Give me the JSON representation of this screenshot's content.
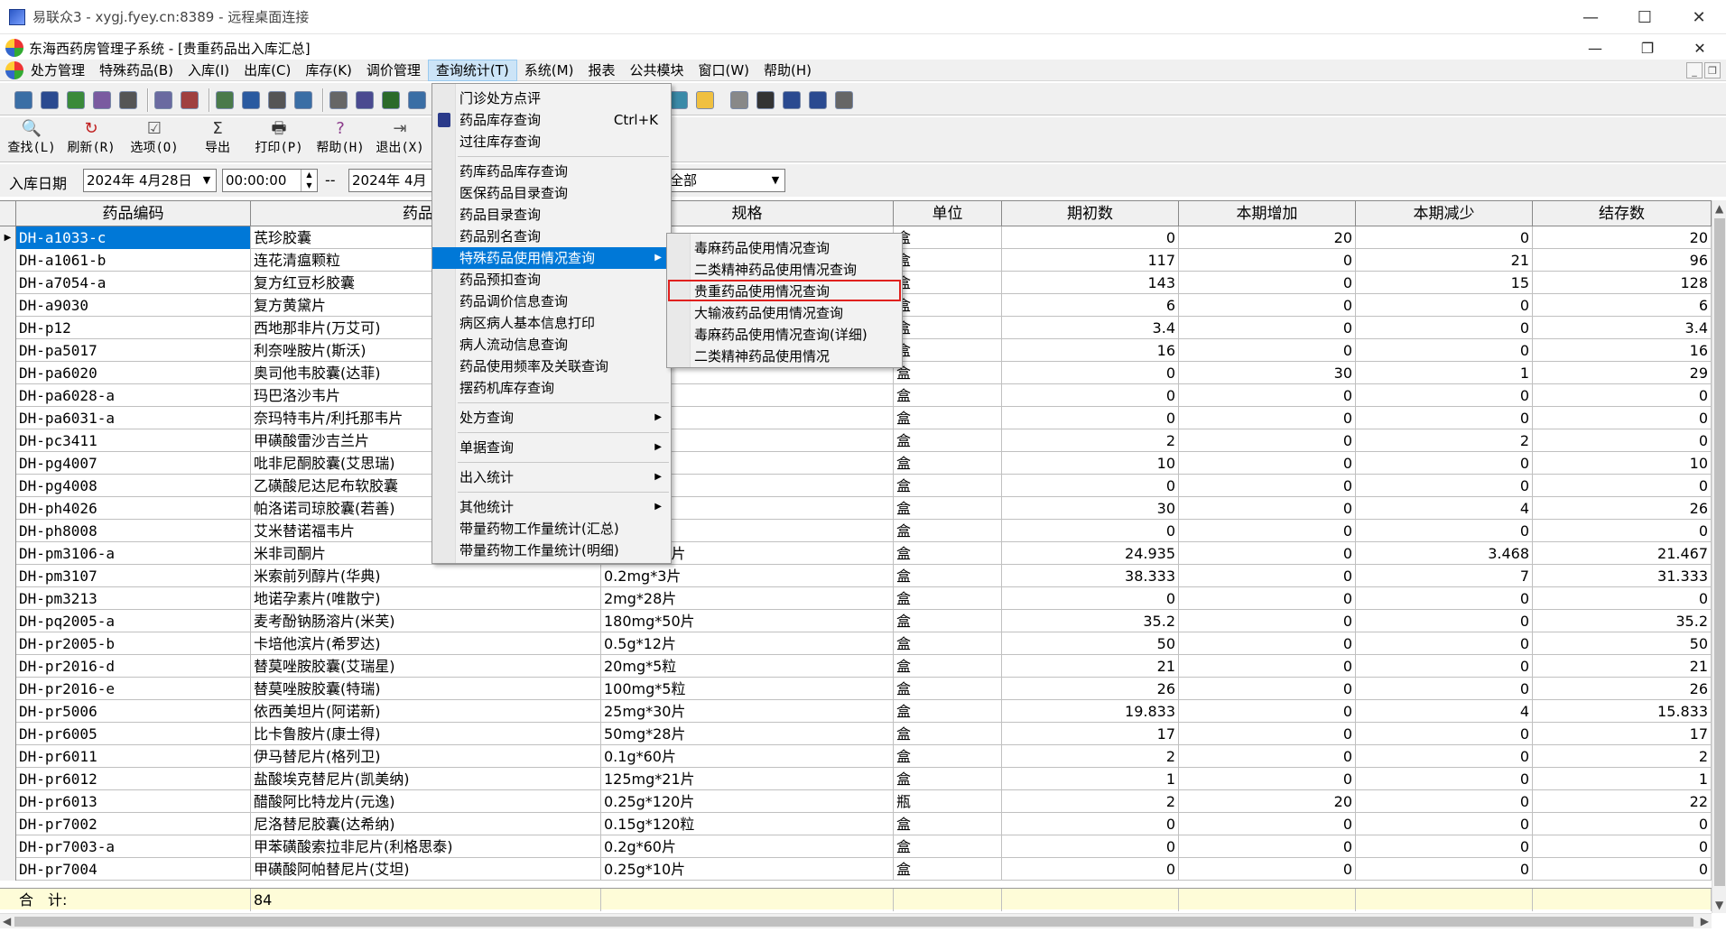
{
  "rd_window": {
    "title": "易联众3 - xygj.fyey.cn:8389 - 远程桌面连接",
    "minimize": "—",
    "maximize": "☐",
    "close": "✕"
  },
  "app_window": {
    "title": "东海西药房管理子系统 - [贵重药品出入库汇总]",
    "minimize": "—",
    "restore": "❐",
    "close": "✕"
  },
  "menubar": {
    "items": [
      "处方管理",
      "特殊药品(B)",
      "入库(I)",
      "出库(C)",
      "库存(K)",
      "调价管理",
      "查询统计(T)",
      "系统(M)",
      "报表",
      "公共模块",
      "窗口(W)",
      "帮助(H)"
    ],
    "active_index": 6,
    "mdi_minimize": "_",
    "mdi_restore": "❐"
  },
  "toolbar": {
    "buttons": [
      {
        "label": "查找(L)",
        "icon": "search-icon",
        "glyph": "🔍"
      },
      {
        "label": "刷新(R)",
        "icon": "refresh-icon",
        "glyph": "↻"
      },
      {
        "label": "选项(O)",
        "icon": "options-icon",
        "glyph": "☑"
      },
      {
        "label": "导出",
        "icon": "export-icon",
        "glyph": "Σ"
      },
      {
        "label": "打印(P)",
        "icon": "print-icon",
        "glyph": "🖶"
      },
      {
        "label": "帮助(H)",
        "icon": "help-icon",
        "glyph": "?"
      },
      {
        "label": "退出(X)",
        "icon": "exit-icon",
        "glyph": "⇥"
      }
    ]
  },
  "filter": {
    "label": "入库日期",
    "start_date": "2024年 4月28日",
    "start_time": "00:00:00",
    "separator": "--",
    "end_date": "2024年 4月",
    "scope": "全部"
  },
  "grid": {
    "columns": [
      "药品编码",
      "药品名",
      "规格",
      "单位",
      "期初数",
      "本期增加",
      "本期减少",
      "结存数"
    ],
    "rows": [
      [
        "DH-a1033-c",
        "芪珍胶囊",
        "",
        "盒",
        "0",
        "20",
        "0",
        "20"
      ],
      [
        "DH-a1061-b",
        "连花清瘟颗粒",
        "",
        "盒",
        "117",
        "0",
        "21",
        "96"
      ],
      [
        "DH-a7054-a",
        "复方红豆杉胶囊",
        "",
        "盒",
        "143",
        "0",
        "15",
        "128"
      ],
      [
        "DH-a9030",
        "复方黄黛片",
        "",
        "盒",
        "6",
        "0",
        "0",
        "6"
      ],
      [
        "DH-p12",
        "西地那非片(万艾可)",
        "",
        "盒",
        "3.4",
        "0",
        "0",
        "3.4"
      ],
      [
        "DH-pa5017",
        "利奈唑胺片(斯沃)",
        "",
        "盒",
        "16",
        "0",
        "0",
        "16"
      ],
      [
        "DH-pa6020",
        "奥司他韦胶囊(达菲)",
        "粒",
        "盒",
        "0",
        "30",
        "1",
        "29"
      ],
      [
        "DH-pa6028-a",
        "玛巴洛沙韦片",
        "",
        "盒",
        "0",
        "0",
        "0",
        "0"
      ],
      [
        "DH-pa6031-a",
        "奈玛特韦片/利托那韦片",
        ":1)*10剂",
        "盒",
        "0",
        "0",
        "0",
        "0"
      ],
      [
        "DH-pc3411",
        "甲磺酸雷沙吉兰片",
        "",
        "盒",
        "2",
        "0",
        "2",
        "0"
      ],
      [
        "DH-pg4007",
        "吡非尼酮胶囊(艾思瑞)",
        "粒",
        "盒",
        "10",
        "0",
        "0",
        "10"
      ],
      [
        "DH-pg4008",
        "乙磺酸尼达尼布软胶囊",
        "0粒",
        "盒",
        "0",
        "0",
        "0",
        "0"
      ],
      [
        "DH-ph4026",
        "帕洛诺司琼胶囊(若善)",
        "粒",
        "盒",
        "30",
        "0",
        "4",
        "26"
      ],
      [
        "DH-ph8008",
        "艾米替诺福韦片",
        "片",
        "盒",
        "0",
        "0",
        "0",
        "0"
      ],
      [
        "DH-pm3106-a",
        "米非司酮片",
        "10mg*30片",
        "盒",
        "24.935",
        "0",
        "3.468",
        "21.467"
      ],
      [
        "DH-pm3107",
        "米索前列醇片(华典)",
        "0.2mg*3片",
        "盒",
        "38.333",
        "0",
        "7",
        "31.333"
      ],
      [
        "DH-pm3213",
        "地诺孕素片(唯散宁)",
        "2mg*28片",
        "盒",
        "0",
        "0",
        "0",
        "0"
      ],
      [
        "DH-pq2005-a",
        "麦考酚钠肠溶片(米芙)",
        "180mg*50片",
        "盒",
        "35.2",
        "0",
        "0",
        "35.2"
      ],
      [
        "DH-pr2005-b",
        "卡培他滨片(希罗达)",
        "0.5g*12片",
        "盒",
        "50",
        "0",
        "0",
        "50"
      ],
      [
        "DH-pr2016-d",
        "替莫唑胺胶囊(艾瑞星)",
        "20mg*5粒",
        "盒",
        "21",
        "0",
        "0",
        "21"
      ],
      [
        "DH-pr2016-e",
        "替莫唑胺胶囊(特瑞)",
        "100mg*5粒",
        "盒",
        "26",
        "0",
        "0",
        "26"
      ],
      [
        "DH-pr5006",
        "依西美坦片(阿诺新)",
        "25mg*30片",
        "盒",
        "19.833",
        "0",
        "4",
        "15.833"
      ],
      [
        "DH-pr6005",
        "比卡鲁胺片(康士得)",
        "50mg*28片",
        "盒",
        "17",
        "0",
        "0",
        "17"
      ],
      [
        "DH-pr6011",
        "伊马替尼片(格列卫)",
        "0.1g*60片",
        "盒",
        "2",
        "0",
        "0",
        "2"
      ],
      [
        "DH-pr6012",
        "盐酸埃克替尼片(凯美纳)",
        "125mg*21片",
        "盒",
        "1",
        "0",
        "0",
        "1"
      ],
      [
        "DH-pr6013",
        "醋酸阿比特龙片(元逸)",
        "0.25g*120片",
        "瓶",
        "2",
        "20",
        "0",
        "22"
      ],
      [
        "DH-pr7002",
        "尼洛替尼胶囊(达希纳)",
        "0.15g*120粒",
        "盒",
        "0",
        "0",
        "0",
        "0"
      ],
      [
        "DH-pr7003-a",
        "甲苯磺酸索拉非尼片(利格思泰)",
        "0.2g*60片",
        "盒",
        "0",
        "0",
        "0",
        "0"
      ],
      [
        "DH-pr7004",
        "甲磺酸阿帕替尼片(艾坦)",
        "0.25g*10片",
        "盒",
        "0",
        "0",
        "0",
        "0"
      ]
    ],
    "summary_label": "合　计:",
    "summary_count": "84",
    "row_marker": "▶"
  },
  "query_menu": {
    "items": [
      {
        "label": "门诊处方点评"
      },
      {
        "label": "药品库存查询",
        "shortcut": "Ctrl+K",
        "icon": "bag-icon"
      },
      {
        "label": "过往库存查询"
      },
      {
        "sep": true
      },
      {
        "label": "药库药品库存查询"
      },
      {
        "label": "医保药品目录查询"
      },
      {
        "label": "药品目录查询"
      },
      {
        "label": "药品别名查询"
      },
      {
        "label": "特殊药品使用情况查询",
        "submenu": true,
        "highlighted": true
      },
      {
        "label": "药品预扣查询"
      },
      {
        "label": "药品调价信息查询"
      },
      {
        "label": "病区病人基本信息打印"
      },
      {
        "label": "病人流动信息查询"
      },
      {
        "label": "药品使用频率及关联查询"
      },
      {
        "label": "摆药机库存查询"
      },
      {
        "sep": true
      },
      {
        "label": "处方查询",
        "submenu": true
      },
      {
        "sep": true
      },
      {
        "label": "单据查询",
        "submenu": true
      },
      {
        "sep": true
      },
      {
        "label": "出入统计",
        "submenu": true
      },
      {
        "sep": true
      },
      {
        "label": "其他统计",
        "submenu": true
      },
      {
        "label": "带量药物工作量统计(汇总)"
      },
      {
        "label": "带量药物工作量统计(明细)"
      }
    ]
  },
  "special_submenu": {
    "items": [
      "毒麻药品使用情况查询",
      "二类精神药品使用情况查询",
      "贵重药品使用情况查询",
      "大输液药品使用情况查询",
      "毒麻药品使用情况查询(详细)",
      "二类精神药品使用情况"
    ],
    "boxed_index": 2
  },
  "colors": {
    "selection": "#0078d7",
    "highlight_box": "#e0201e",
    "summary_bg": "#fefcd8"
  }
}
